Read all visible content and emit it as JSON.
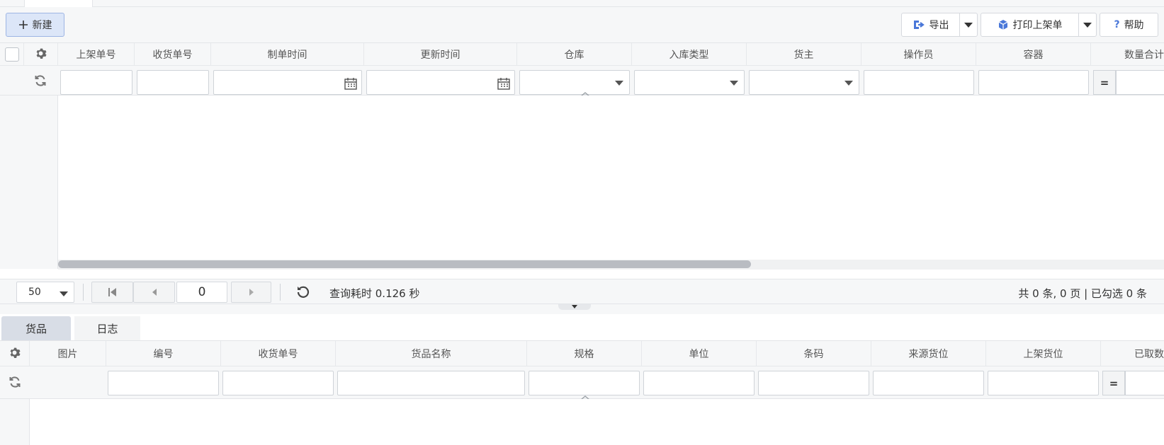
{
  "toolbar": {
    "new_label": "新建",
    "export_label": "导出",
    "print_label": "打印上架单",
    "help_label": "帮助"
  },
  "main_grid": {
    "columns": [
      "上架单号",
      "收货单号",
      "制单时间",
      "更新时间",
      "仓库",
      "入库类型",
      "货主",
      "操作员",
      "容器",
      "数量合计"
    ],
    "eq_symbol": "="
  },
  "pager": {
    "page_size": "50",
    "page_number": "0",
    "query_time": "查询耗时 0.126 秒",
    "summary": "共 0 条, 0 页 | 已勾选 0 条"
  },
  "tabs": [
    "货品",
    "日志"
  ],
  "detail_grid": {
    "columns": [
      "图片",
      "编号",
      "收货单号",
      "货品名称",
      "规格",
      "单位",
      "条码",
      "来源货位",
      "上架货位",
      "已取数"
    ],
    "eq_symbol": "="
  },
  "colors": {
    "accent": "#4a78d9",
    "toolbar_bg": "#f6f7f8",
    "new_button_bg": "#dce6f8",
    "scroll_thumb": "#b9bcc2"
  }
}
